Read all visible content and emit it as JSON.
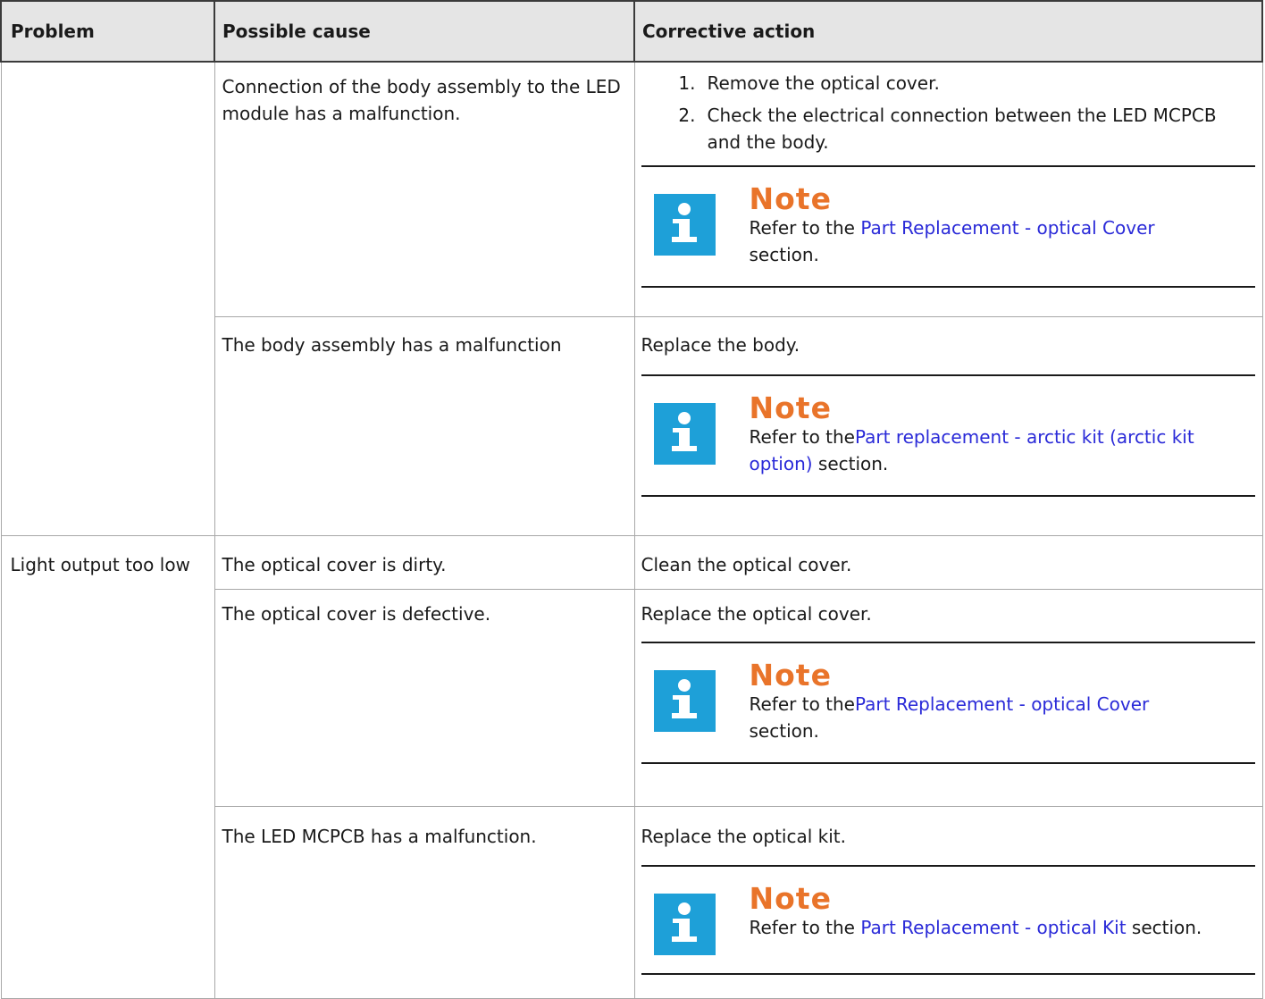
{
  "table": {
    "headers": {
      "problem": "Problem",
      "cause": "Possible cause",
      "action": "Corrective action"
    },
    "note_title": "Note",
    "rows": [
      {
        "problem": "",
        "cause": "Connection of the body assembly to the LED module has a malfunction.",
        "steps": [
          {
            "num": "1.",
            "text": "Remove the optical cover."
          },
          {
            "num": "2.",
            "text": "Check the electrical connection between the LED MCPCB and the body."
          }
        ],
        "note": {
          "before": "Refer to the ",
          "link": "Part Replacement - optical Cover",
          "after": " section."
        }
      },
      {
        "cause": "The body assembly has a malfunction",
        "action": "Replace the body.",
        "note": {
          "before": "Refer to the",
          "link": "Part replacement - arctic kit (arctic kit option)",
          "after": " section."
        }
      },
      {
        "problem": "Light output too low",
        "cause": "The optical cover is dirty.",
        "action": "Clean the optical cover."
      },
      {
        "cause": "The optical cover is defective.",
        "action": "Replace the optical cover.",
        "note": {
          "before": "Refer to the",
          "link": "Part Replacement - optical Cover",
          "after": " section."
        }
      },
      {
        "cause": "The LED MCPCB has a malfunction.",
        "action": "Replace the optical kit.",
        "note": {
          "before": "Refer to the ",
          "link": "Part Replacement - optical Kit",
          "after": " section."
        }
      }
    ]
  },
  "colors": {
    "note_title": "#e9742a",
    "info_icon_bg": "#1ea0d8",
    "link": "#2a2ad8",
    "header_bg": "#e5e5e5"
  },
  "icons": {
    "note": "info-icon"
  }
}
